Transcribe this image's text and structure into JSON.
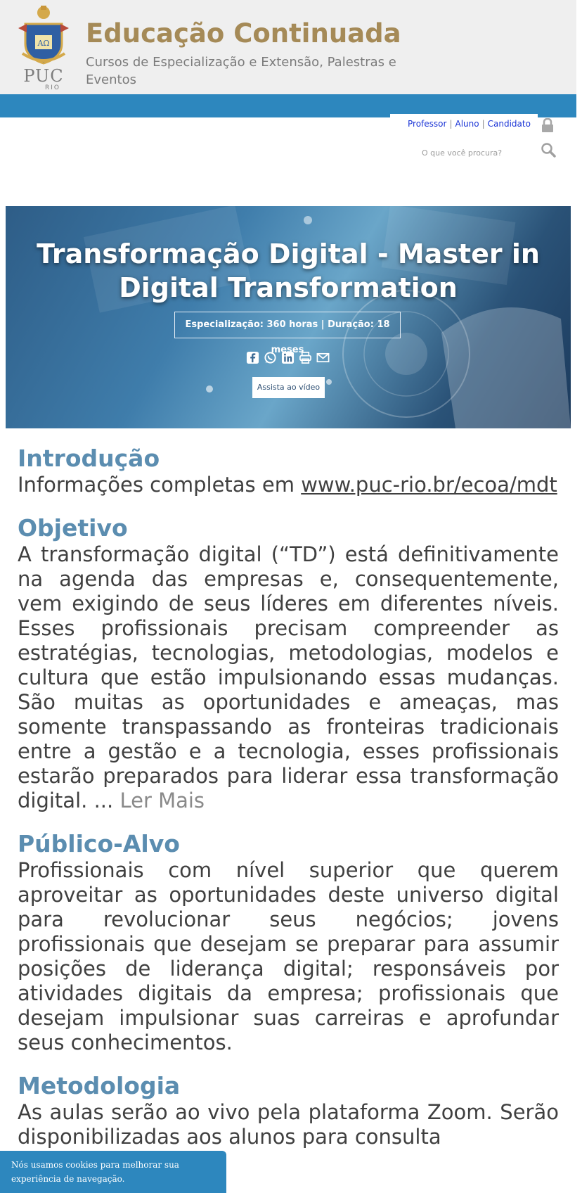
{
  "header": {
    "logo_text": "PUC",
    "logo_sub": "RIO",
    "title": "Educação Continuada",
    "subtitle": "Cursos de Especialização e Extensão, Palestras e Eventos"
  },
  "login": {
    "links": [
      "Professor",
      "Aluno",
      "Candidato"
    ]
  },
  "search": {
    "placeholder": "O que você procura?"
  },
  "hero": {
    "title": "Transformação Digital - Master in Digital Transformation",
    "badge": "Especialização: 360 horas | Duração: 18 meses",
    "share_icons": [
      "facebook-icon",
      "whatsapp-icon",
      "linkedin-icon",
      "print-icon",
      "mail-icon"
    ],
    "video_button": "Assista ao vídeo"
  },
  "sections": {
    "intro": {
      "title": "Introdução",
      "text": "Informações completas em ",
      "link": "www.puc-rio.br/ecoa/mdt"
    },
    "objective": {
      "title": "Objetivo",
      "text": "A transformação digital (“TD”) está definitivamente na agenda das empresas e, consequentemente, vem exigindo de seus líderes em diferentes níveis. Esses profissionais precisam compreender as estratégias, tecnologias, metodologias, modelos e cultura que estão impulsionando essas mudanças.  São muitas as oportunidades e ameaças, mas somente transpassando as fronteiras tradicionais entre a gestão e a tecnologia, esses profissionais estarão preparados para liderar essa transformação digital. ...",
      "read_more": "Ler Mais"
    },
    "audience": {
      "title": "Público-Alvo",
      "text": "Profissionais com nível superior que querem aproveitar as oportunidades deste universo digital para revolucionar seus negócios; jovens profissionais que desejam se preparar para assumir posições de liderança digital; responsáveis por atividades digitais da empresa; profissionais que desejam impulsionar suas carreiras e aprofundar seus conhecimentos."
    },
    "methodology": {
      "title": "Metodologia",
      "text": "As aulas serão ao vivo pela plataforma Zoom. Serão disponibilizadas aos alunos para consulta"
    }
  },
  "cookie": {
    "text": "Nós usamos cookies para melhorar sua experiência de navegação."
  },
  "colors": {
    "brand_gold": "#a58a57",
    "brand_blue": "#2d87be",
    "heading_blue": "#5b8db0"
  }
}
